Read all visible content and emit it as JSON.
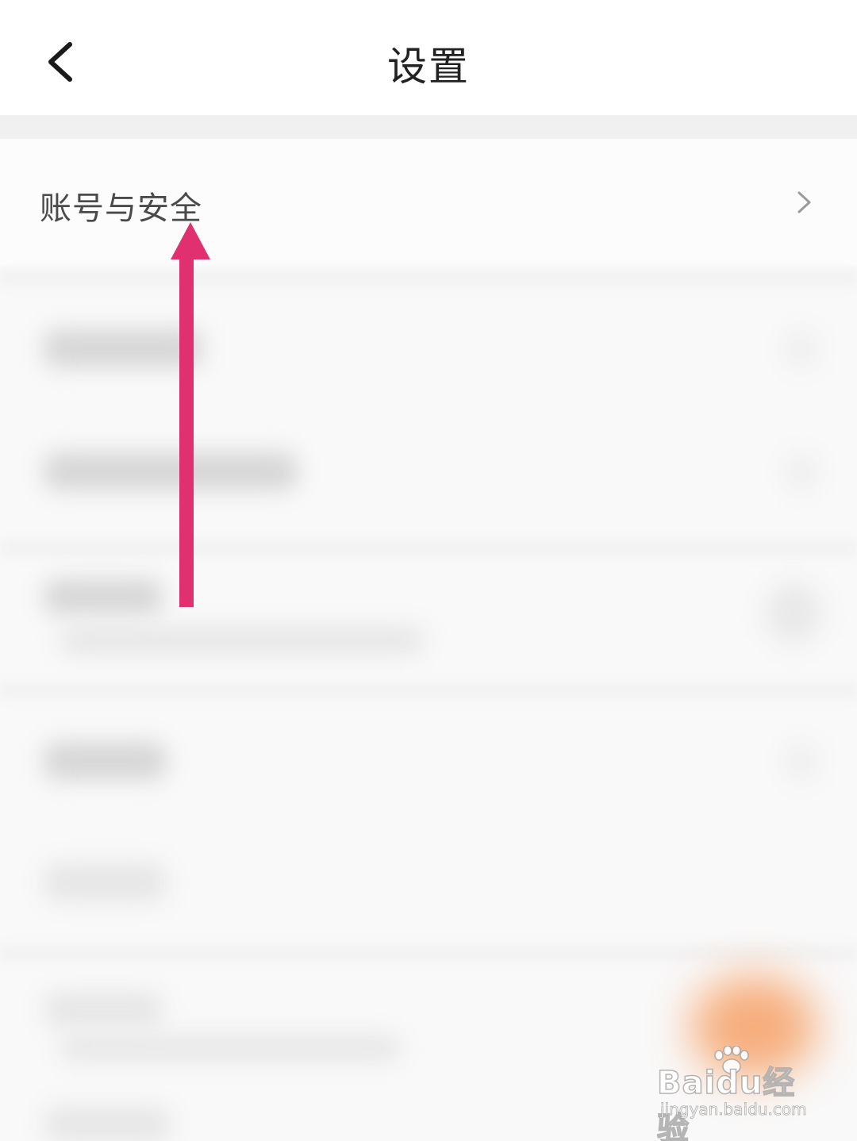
{
  "header": {
    "title": "设置",
    "back_icon": "chevron-left-icon"
  },
  "settings": {
    "items": [
      {
        "label": "账号与安全",
        "icon": "chevron-right-icon"
      }
    ]
  },
  "annotation": {
    "arrow_color": "#e0306f"
  },
  "watermark": {
    "logo": "Baidu经验",
    "url": "jingyan.baidu.com"
  }
}
